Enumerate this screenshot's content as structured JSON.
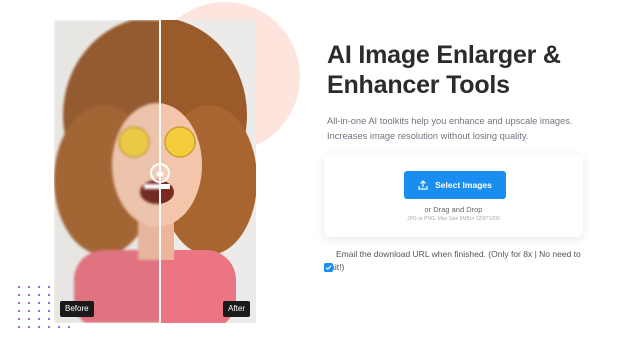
{
  "hero": {
    "title": "AI Image Enlarger & Enhancer Tools",
    "subtitle": "All-in-one AI toolkits help you enhance and upscale images. Increases image resolution without losing quality."
  },
  "compare": {
    "before_label": "Before",
    "after_label": "After"
  },
  "upload": {
    "button_label": "Select Images",
    "drag_text": "or Drag and Drop",
    "limits_text": "JPG or PNG. Max Size 5MBor 1200*1200"
  },
  "email_option": {
    "label": "Email the download URL when finished. (Only for 8x | No need to wait!)",
    "checked": true
  },
  "colors": {
    "accent": "#1a8ef0",
    "decor_circle": "#fde4dc",
    "decor_dots": "#7d3cc6"
  }
}
